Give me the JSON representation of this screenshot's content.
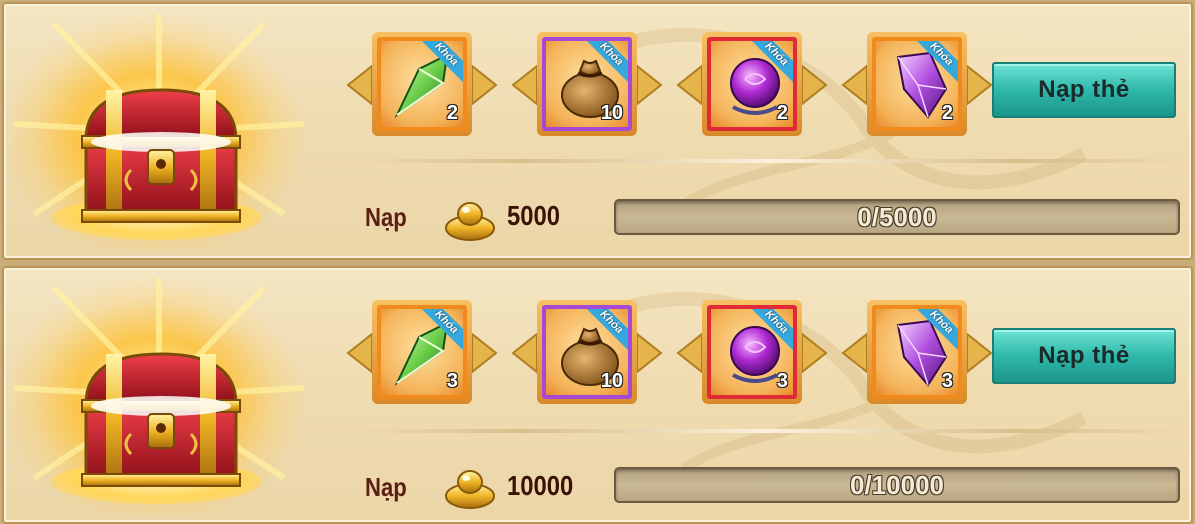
{
  "tiers": [
    {
      "items": [
        {
          "icon": "green-crystal-icon",
          "badge": "Khóa",
          "qty": "2",
          "rarity": "orange"
        },
        {
          "icon": "coin-bag-icon",
          "badge": "Khóa",
          "qty": "10",
          "rarity": "purple"
        },
        {
          "icon": "purple-orb-icon",
          "badge": "Khóa",
          "qty": "2",
          "rarity": "red"
        },
        {
          "icon": "purple-gem-icon",
          "badge": "Khóa",
          "qty": "2",
          "rarity": "orange"
        }
      ],
      "button_label": "Nạp thẻ",
      "req_label": "Nạp",
      "req_icon": "gold-ingot-icon",
      "amount": "5000",
      "progress_text": "0/5000",
      "progress": 0
    },
    {
      "items": [
        {
          "icon": "green-crystal-icon",
          "badge": "Khóa",
          "qty": "3",
          "rarity": "orange"
        },
        {
          "icon": "coin-bag-icon",
          "badge": "Khóa",
          "qty": "10",
          "rarity": "purple"
        },
        {
          "icon": "purple-orb-icon",
          "badge": "Khóa",
          "qty": "3",
          "rarity": "red"
        },
        {
          "icon": "purple-gem-icon",
          "badge": "Khóa",
          "qty": "3",
          "rarity": "orange"
        }
      ],
      "button_label": "Nạp thẻ",
      "req_label": "Nạp",
      "req_icon": "gold-ingot-icon",
      "amount": "10000",
      "progress_text": "0/10000",
      "progress": 0
    }
  ],
  "colors": {
    "button": "#2fb8aa",
    "ribbon": "#35a9dd",
    "frame_orange": "#f08a1c",
    "frame_purple": "#a649d6",
    "frame_red": "#e02a38"
  }
}
